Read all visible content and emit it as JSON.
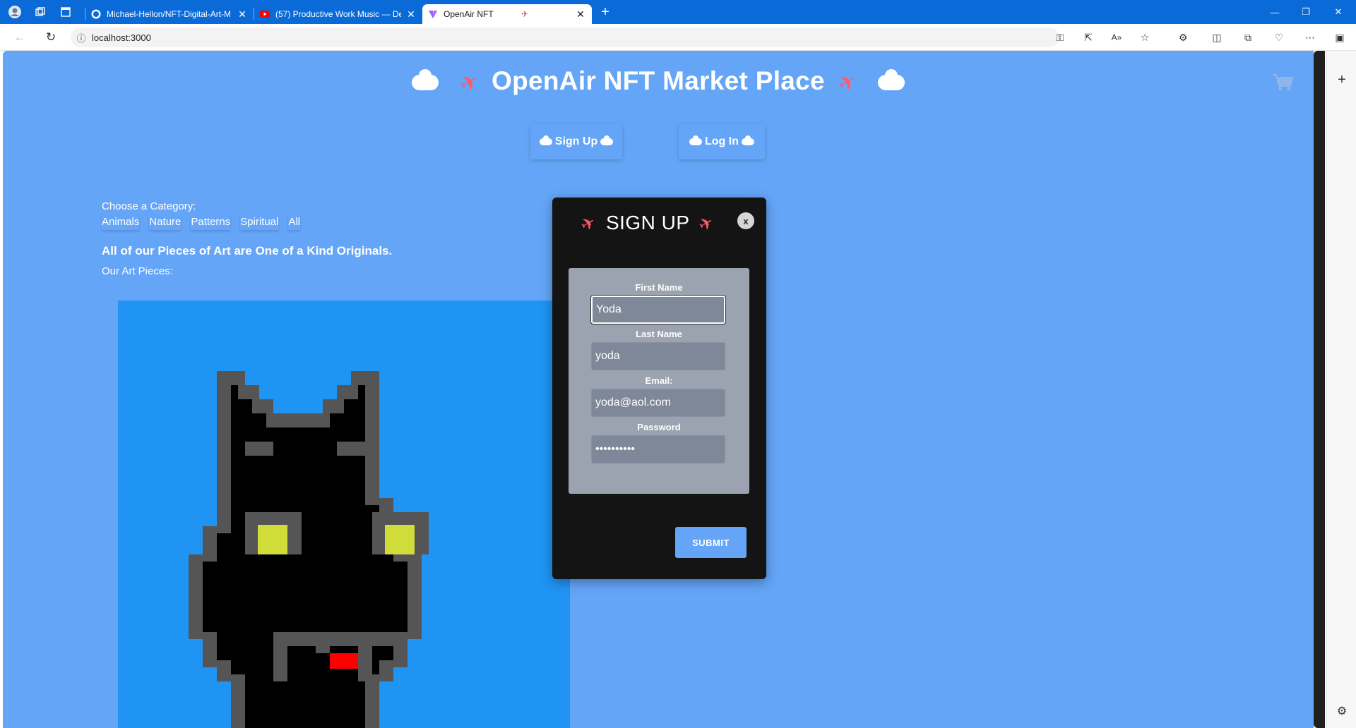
{
  "browser": {
    "tabs": [
      {
        "title": "Michael-Hellon/NFT-Digital-Art-M",
        "favicon": "github-icon"
      },
      {
        "title": "(57) Productive Work Music — De",
        "favicon": "youtube-icon"
      },
      {
        "title": "OpenAir NFT",
        "favicon": "vite-icon",
        "active": true
      }
    ],
    "url": "localhost:3000"
  },
  "site": {
    "title": "OpenAir NFT Market Place",
    "signup_label": "Sign Up",
    "login_label": "Log In"
  },
  "categories": {
    "label": "Choose a Category:",
    "items": [
      "Animals",
      "Nature",
      "Patterns",
      "Spiritual",
      "All"
    ]
  },
  "main": {
    "tagline": "All of our Pieces of Art are One of a Kind Originals.",
    "art_label": "Our Art Pieces:"
  },
  "modal": {
    "title": "SIGN UP",
    "close_label": "x",
    "fields": [
      {
        "label": "First Name",
        "value": "Yoda"
      },
      {
        "label": "Last Name",
        "value": "yoda"
      },
      {
        "label": "Email:",
        "value": "yoda@aol.com"
      },
      {
        "label": "Password",
        "value": "••••••••••"
      }
    ],
    "submit_label": "SUBMIT"
  },
  "colors": {
    "page_bg": "#64a5f7",
    "art_bg": "#2094f3",
    "modal_bg": "#141414",
    "form_bg": "#9aa3af",
    "tab_bar": "#0a6ad8"
  }
}
